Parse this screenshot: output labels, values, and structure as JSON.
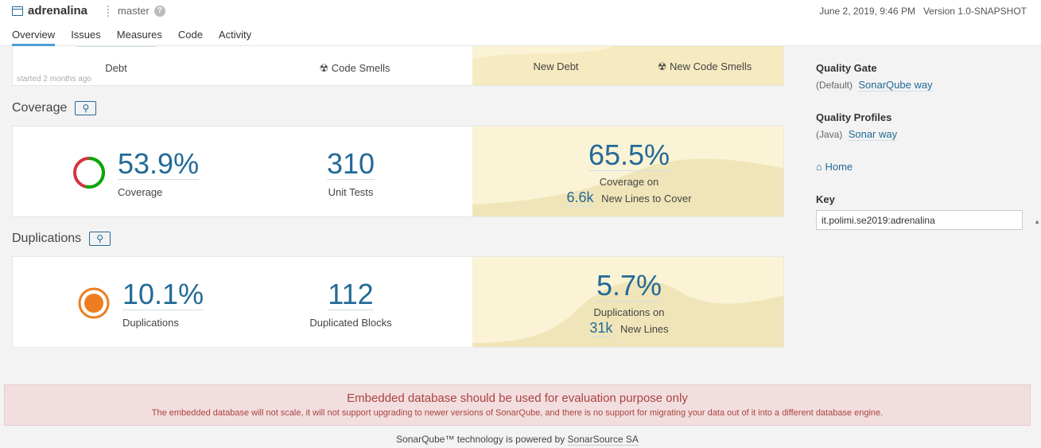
{
  "header": {
    "project_name": "adrenalina",
    "branch": "master",
    "date": "June 2, 2019, 9:46 PM",
    "version": "Version 1.0-SNAPSHOT",
    "tabs": [
      "Overview",
      "Issues",
      "Measures",
      "Code",
      "Activity"
    ]
  },
  "maintainability": {
    "debt_label": "Debt",
    "code_smells_label": "Code Smells",
    "started": "started 2 months ago",
    "new_debt_label": "New Debt",
    "new_code_smells_label": "New Code Smells"
  },
  "coverage": {
    "title": "Coverage",
    "value": "53.9%",
    "label": "Coverage",
    "unit_tests_value": "310",
    "unit_tests_label": "Unit Tests",
    "new_value": "65.5%",
    "new_label": "Coverage on",
    "new_lines_value": "6.6k",
    "new_lines_label": "New Lines to Cover",
    "donut_fraction": 0.539
  },
  "duplications": {
    "title": "Duplications",
    "value": "10.1%",
    "label": "Duplications",
    "blocks_value": "112",
    "blocks_label": "Duplicated Blocks",
    "new_value": "5.7%",
    "new_label": "Duplications on",
    "new_lines_value": "31k",
    "new_lines_label": "New Lines"
  },
  "sidebar": {
    "quality_gate_title": "Quality Gate",
    "quality_gate_prefix": "(Default)",
    "quality_gate_link": "SonarQube way",
    "quality_profiles_title": "Quality Profiles",
    "quality_profiles_prefix": "(Java)",
    "quality_profiles_link": "Sonar way",
    "home_link": "Home",
    "key_title": "Key",
    "key_value": "it.polimi.se2019:adrenalina"
  },
  "alert": {
    "title": "Embedded database should be used for evaluation purpose only",
    "text": "The embedded database will not scale, it will not support upgrading to newer versions of SonarQube, and there is no support for migrating your data out of it into a different database engine."
  },
  "footer": {
    "text": "SonarQube™ technology is powered by",
    "link": "SonarSource SA"
  },
  "colors": {
    "accent": "#236a97",
    "leak_bg": "#fbf3d5",
    "coverage_green": "#00aa00",
    "coverage_red": "#d4333f",
    "duplication_orange": "#ed7d20"
  }
}
